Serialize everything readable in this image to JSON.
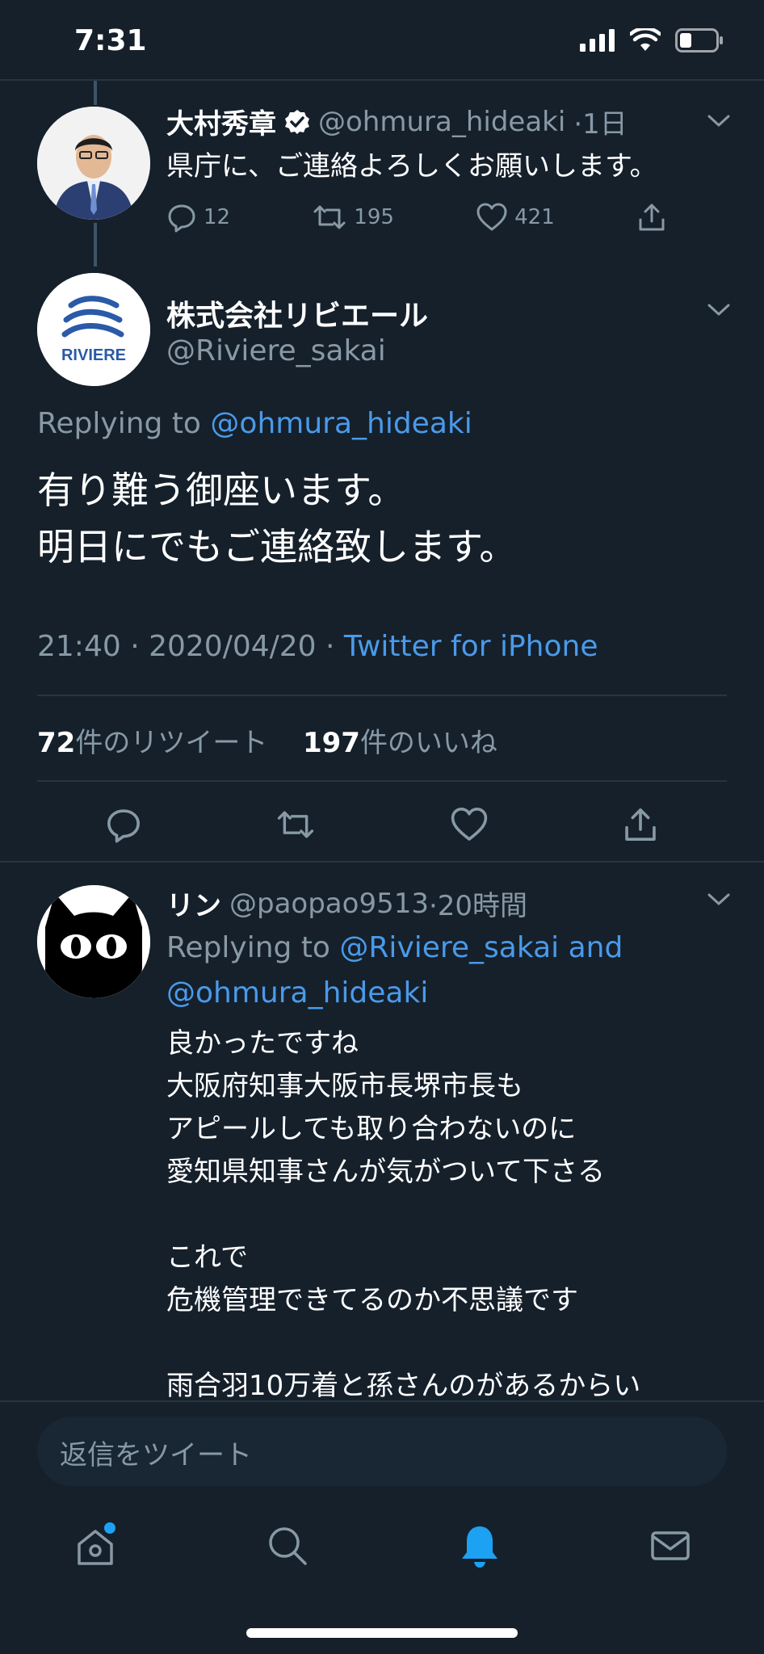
{
  "status_bar": {
    "time": "7:31"
  },
  "colors": {
    "background": "#15202b",
    "accent": "#1da1f2",
    "link": "#4a9ae9",
    "muted": "#8899a6",
    "divider": "#263542"
  },
  "parent_tweet": {
    "name": "大村秀章",
    "handle": "@ohmura_hideaki",
    "time": "·1日",
    "text": "県庁に、ご連絡よろしくお願いします。",
    "replies": "12",
    "retweets": "195",
    "likes": "421"
  },
  "main_tweet": {
    "name": "株式会社リビエール",
    "handle": "@Riviere_sakai",
    "avatar_text": "RIVIERE",
    "replying_prefix": "Replying to",
    "replying_to": "@ohmura_hideaki",
    "text_line1": "有り難う御座います。",
    "text_line2": "明日にでもご連絡致します。",
    "timestamp": "21:40 · 2020/04/20 · ",
    "source": "Twitter for iPhone",
    "retweet_count": "72",
    "retweet_label": "件のリツイート",
    "like_count": "197",
    "like_label": "件のいいね"
  },
  "reply_tweet": {
    "name": "リン",
    "handle": "@paopao9513",
    "time": "·20時間",
    "replying_prefix": "Replying to",
    "replying_to_1": "@Riviere_sakai",
    "replying_and": "and",
    "replying_to_2": "@ohmura_hideaki",
    "text": "良かったですね\n大阪府知事大阪市長堺市長も\nアピールしても取り合わないのに\n愛知県知事さんが気がついて下さる\n\nこれで\n危機管理できてるのか不思議です\n\n雨合羽10万着と孫さんのがあるからい"
  },
  "reply_box": {
    "placeholder": "返信をツイート"
  },
  "tab_bar": {
    "icons": [
      "home-icon",
      "search-icon",
      "notifications-icon",
      "messages-icon"
    ]
  }
}
